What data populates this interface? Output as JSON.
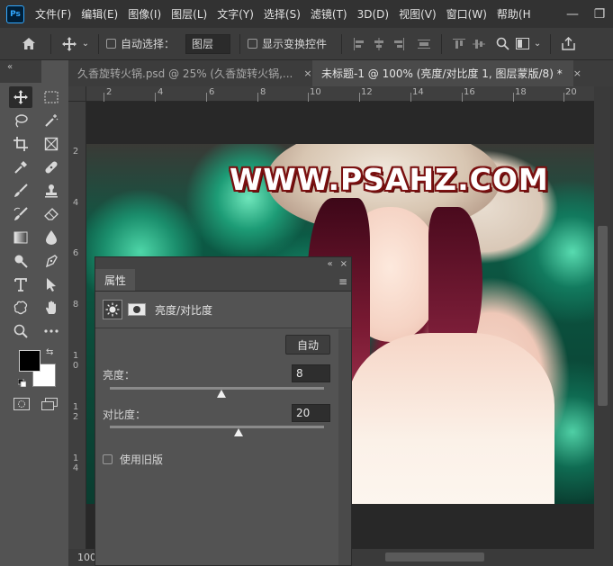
{
  "menubar": {
    "logo": "Ps",
    "items": [
      "文件(F)",
      "编辑(E)",
      "图像(I)",
      "图层(L)",
      "文字(Y)",
      "选择(S)",
      "滤镜(T)",
      "3D(D)",
      "视图(V)",
      "窗口(W)",
      "帮助(H"
    ],
    "minimize": "—",
    "restore": "❐"
  },
  "optbar": {
    "auto_select_label": "自动选择：",
    "layer_select": "图层",
    "show_transform_label": "显示变换控件"
  },
  "left_collapse": "«",
  "tabs": [
    {
      "label": "久香旋转火锅.psd @ 25% (久香旋转火锅,...",
      "close": "×"
    },
    {
      "label": "未标题-1 @ 100% (亮度/对比度 1, 图层蒙版/8) *",
      "close": "×"
    }
  ],
  "ruler_top": [
    "2",
    "4",
    "6",
    "8",
    "10",
    "12",
    "14",
    "16",
    "18",
    "20"
  ],
  "ruler_left": [
    [
      "2"
    ],
    [
      "4"
    ],
    [
      "6"
    ],
    [
      "8"
    ],
    [
      "1",
      "0"
    ],
    [
      "1",
      "2"
    ],
    [
      "1",
      "4"
    ]
  ],
  "watermark": "WWW.PSAHZ.COM",
  "zoom": "100",
  "properties": {
    "top_collapse": "«",
    "top_close": "×",
    "tab": "属性",
    "menu": "≡",
    "adjustment_label": "亮度/对比度",
    "auto_button": "自动",
    "brightness_label": "亮度：",
    "brightness_value": "8",
    "brightness_pos": 0.52,
    "contrast_label": "对比度：",
    "contrast_value": "20",
    "contrast_pos": 0.6,
    "legacy_label": "使用旧版"
  }
}
